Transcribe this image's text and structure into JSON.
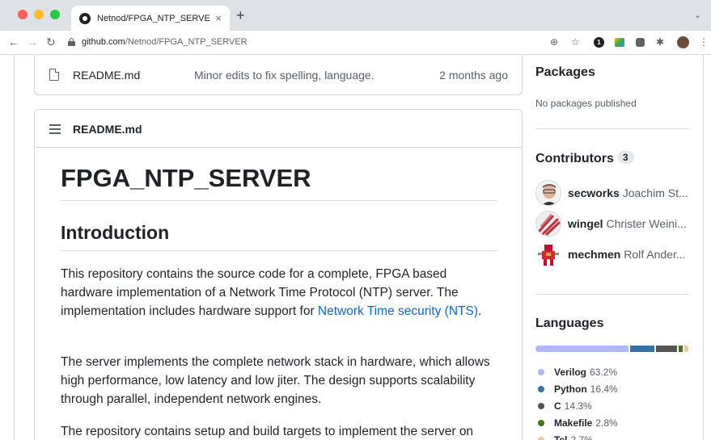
{
  "browser": {
    "tab_title": "Netnod/FPGA_NTP_SERVER",
    "tab_close": "×",
    "new_tab": "+",
    "tab_menu": "⌄",
    "url_domain": "github.com",
    "url_path": "/Netnod/FPGA_NTP_SERVER",
    "extension_badge": "1"
  },
  "file_list": {
    "row": {
      "name": "README.md",
      "message": "Minor edits to fix spelling, language.",
      "date": "2 months ago"
    }
  },
  "readme": {
    "header_title": "README.md",
    "h1": "FPGA_NTP_SERVER",
    "h2": "Introduction",
    "p1_before": "This repository contains the source code for a complete, FPGA based hardware implementation of a Network Time Protocol (NTP) server. The implementation includes hardware support for ",
    "p1_link": "Network Time security (NTS)",
    "p1_after": ".",
    "p2": "The server implements the complete network stack in hardware, which allows high performance, low latency and low jiter. The design supports scalability through parallel, independent network engines.",
    "p3": "The repository contains setup and build targets to implement the server on"
  },
  "sidebar": {
    "packages_title": "Packages",
    "packages_empty": "No packages published",
    "contributors_title": "Contributors",
    "contributors_count": "3",
    "contributors": [
      {
        "login": "secworks",
        "name": "Joachim St..."
      },
      {
        "login": "wingel",
        "name": "Christer Weini..."
      },
      {
        "login": "mechmen",
        "name": "Rolf Ander..."
      }
    ],
    "languages_title": "Languages",
    "languages": [
      {
        "name": "Verilog",
        "percent": "63.2%",
        "value": 63.2,
        "color": "#b2b7f8"
      },
      {
        "name": "Python",
        "percent": "16.4%",
        "value": 16.4,
        "color": "#3572a5"
      },
      {
        "name": "C",
        "percent": "14.3%",
        "value": 14.3,
        "color": "#555555"
      },
      {
        "name": "Makefile",
        "percent": "2.8%",
        "value": 2.8,
        "color": "#427819"
      },
      {
        "name": "Tcl",
        "percent": "2.7%",
        "value": 2.7,
        "color": "#e4cc98"
      }
    ]
  },
  "colors": {
    "link": "#0969da",
    "text": "#1f2328",
    "muted": "#57606a",
    "border": "#d0d7de"
  }
}
